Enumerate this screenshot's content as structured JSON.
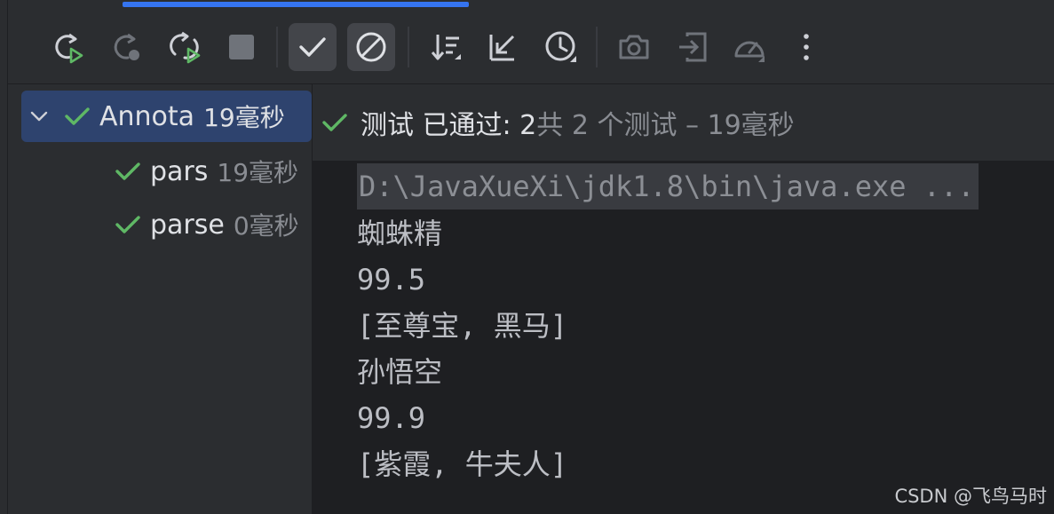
{
  "toolbar": {
    "buttons": [
      {
        "name": "rerun-icon",
        "active": false
      },
      {
        "name": "rerun-failed-icon",
        "active": false
      },
      {
        "name": "toggle-auto-test-icon",
        "active": false
      },
      {
        "name": "stop-icon",
        "active": false
      },
      {
        "name": "show-passed-icon",
        "active": true
      },
      {
        "name": "show-ignored-icon",
        "active": true
      },
      {
        "name": "sort-icon",
        "active": false
      },
      {
        "name": "collapse-icon",
        "active": false
      },
      {
        "name": "history-icon",
        "active": false
      },
      {
        "name": "screenshot-icon",
        "active": false
      },
      {
        "name": "import-tests-icon",
        "active": false
      },
      {
        "name": "profiler-icon",
        "active": false
      },
      {
        "name": "more-options-icon",
        "active": false
      }
    ]
  },
  "tree": {
    "root": {
      "name": "Annota",
      "time": "19毫秒"
    },
    "children": [
      {
        "name": "pars",
        "time": "19毫秒"
      },
      {
        "name": "parse",
        "time": "0毫秒"
      }
    ]
  },
  "status": {
    "strong": "测试 已通过: 2",
    "dim": "共 2 个测试 – 19毫秒"
  },
  "console": {
    "lines": [
      "D:\\JavaXueXi\\jdk1.8\\bin\\java.exe ...",
      "蜘蛛精",
      "99.5",
      "[至尊宝, 黑马]",
      "孙悟空",
      "99.9",
      "[紫霞, 牛夫人]"
    ]
  },
  "watermark": "CSDN @飞鸟马时",
  "colors": {
    "accent": "#3574f0",
    "pass_green": "#5fb865",
    "selection": "#2e436e",
    "console_bg": "#1e1f22",
    "panel_bg": "#2b2d30"
  }
}
